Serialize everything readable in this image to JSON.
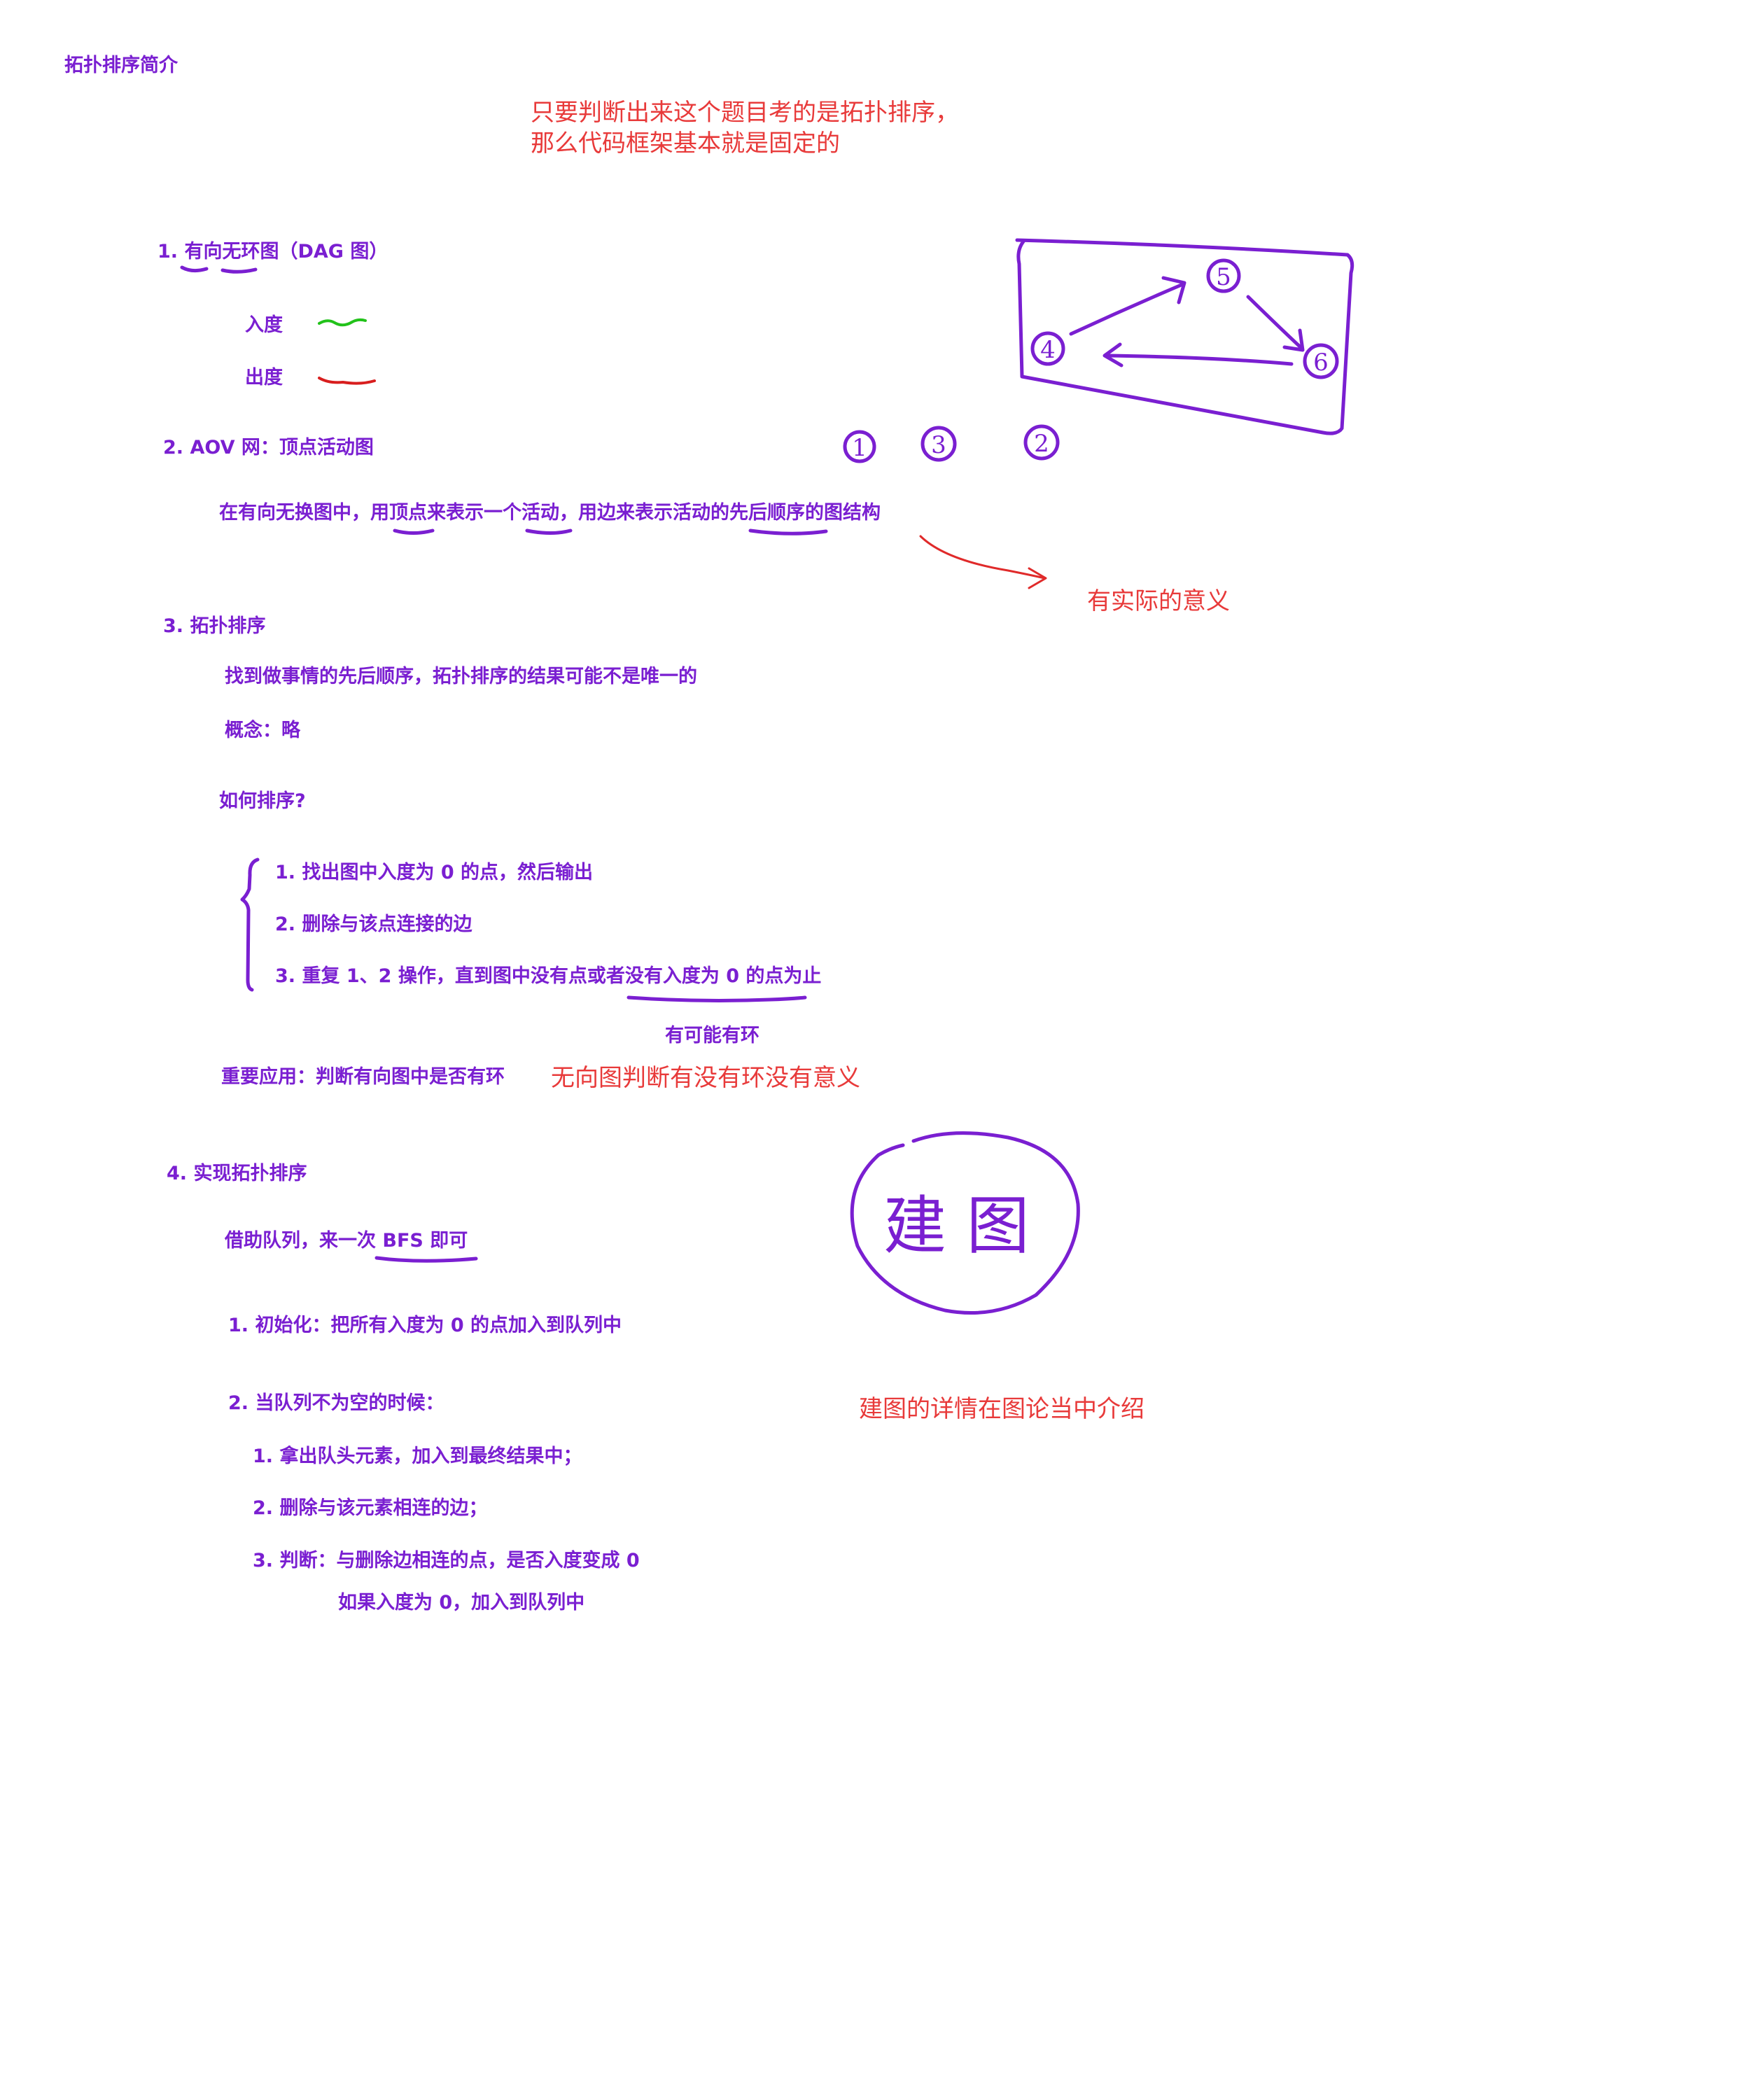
{
  "title": "拓扑排序简介",
  "note_top": [
    "只要判断出来这个题目考的是拓扑排序，",
    "那么代码框架基本就是固定的"
  ],
  "s1": {
    "heading": "1. 有向无环图（DAG 图）",
    "indegree": "入度",
    "outdegree": "出度"
  },
  "s2": {
    "heading": "2. AOV 网：顶点活动图",
    "desc": "在有向无换图中，用顶点来表示一个活动，用边来表示活动的先后顺序的图结构",
    "note": "有实际的意义"
  },
  "s3": {
    "heading": "3. 拓扑排序",
    "desc": "找到做事情的先后顺序，拓扑排序的结果可能不是唯一的",
    "concept": "概念：略",
    "how": "如何排序?",
    "steps": [
      "1. 找出图中入度为 0 的点，然后输出",
      "2. 删除与该点连接的边",
      "3. 重复 1、2 操作，直到图中没有点或者没有入度为 0 的点为止"
    ],
    "cycle_note": "有可能有环",
    "application": "重要应用：判断有向图中是否有环",
    "undirected_note": "无向图判断有没有环没有意义"
  },
  "s4": {
    "heading": "4. 实现拓扑排序",
    "queue": "借助队列，来一次 BFS 即可",
    "init": "1. 初始化：把所有入度为 0 的点加入到队列中",
    "loop": "2. 当队列不为空的时候：",
    "substeps": [
      "1. 拿出队头元素，加入到最终结果中；",
      "2. 删除与该元素相连的边；",
      "3. 判断：与删除边相连的点，是否入度变成 0"
    ],
    "substep_cont": "如果入度为 0，加入到队列中",
    "build_graph": "建 图",
    "build_note": "建图的详情在图论当中介绍"
  },
  "diagram": {
    "nodes": [
      "4",
      "5",
      "6"
    ],
    "order": [
      "1",
      "3",
      "2"
    ]
  },
  "colors": {
    "heading": "#7a1fd1",
    "annotation": "#e83a3a",
    "indegree_mark": "#22c21a",
    "outdegree_mark": "#d81e1e"
  }
}
